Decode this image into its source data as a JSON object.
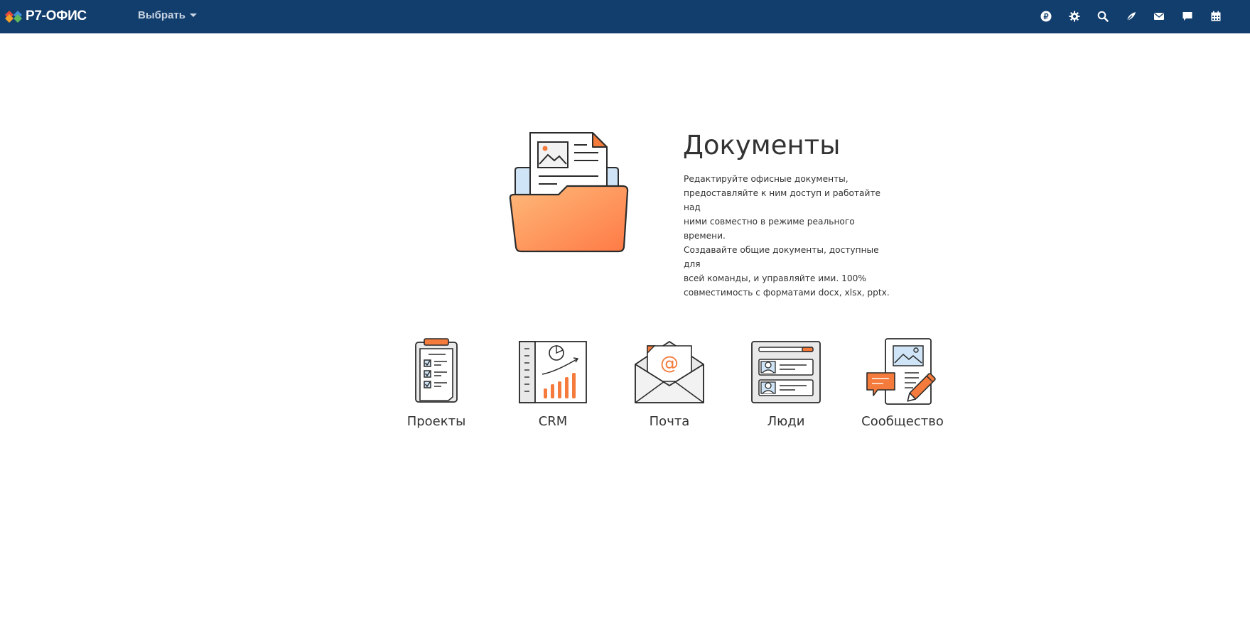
{
  "header": {
    "logo_text": "Р7-ОФИС",
    "select_label": "Выбрать",
    "icons": [
      "ruble-icon",
      "gear-icon",
      "search-icon",
      "feed-icon",
      "mail-icon",
      "chat-icon",
      "calendar-icon"
    ]
  },
  "hero": {
    "title": "Документы",
    "description_lines": [
      "Редактируйте офисные документы,",
      "предоставляйте к ним доступ и работайте над",
      "ними совместно в режиме реального времени.",
      "Создавайте общие документы, доступные для",
      "всей команды, и управляйте ими. 100%",
      "совместимость с форматами docx, xlsx, pptx."
    ]
  },
  "modules": [
    {
      "label": "Проекты",
      "icon": "clipboard-checklist-icon"
    },
    {
      "label": "CRM",
      "icon": "crm-chart-icon"
    },
    {
      "label": "Почта",
      "icon": "mail-envelope-icon"
    },
    {
      "label": "Люди",
      "icon": "people-cards-icon"
    },
    {
      "label": "Сообщество",
      "icon": "community-icon"
    }
  ],
  "colors": {
    "topbar": "#123e6e",
    "accent_orange": "#f47b3b",
    "text": "#333333",
    "icon_light_blue": "#cfe5f7"
  }
}
